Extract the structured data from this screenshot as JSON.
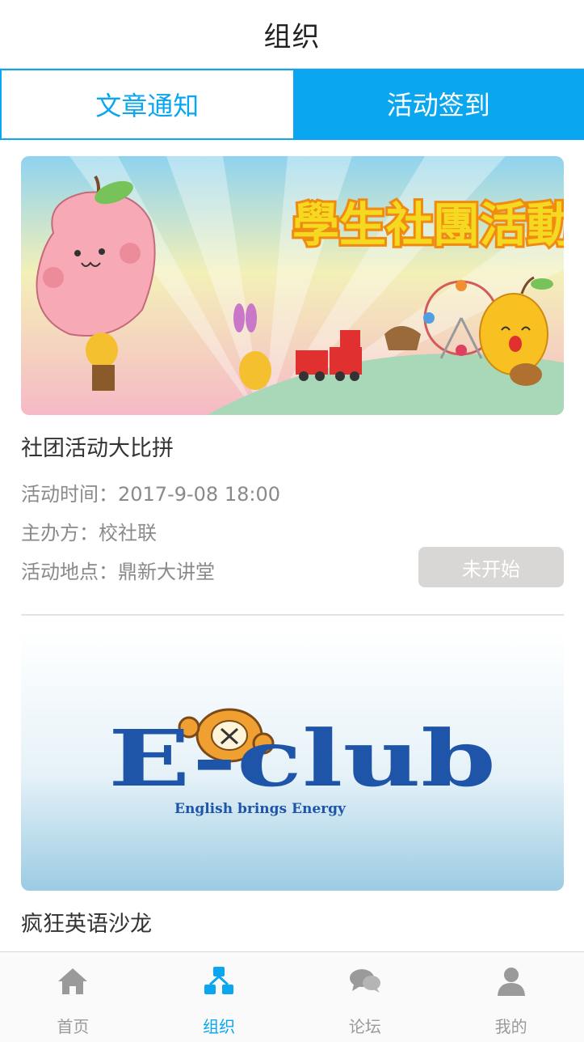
{
  "header": {
    "title": "组织"
  },
  "tabs": [
    {
      "label": "文章通知",
      "active": false
    },
    {
      "label": "活动签到",
      "active": true
    }
  ],
  "activities": [
    {
      "banner_text": "學生社團活動",
      "title": "社团活动大比拼",
      "time": "活动时间：2017-9-08 18:00",
      "organizer": "主办方：校社联",
      "location": "活动地点：鼎新大讲堂",
      "status": "未开始"
    },
    {
      "banner_title": "E-club",
      "banner_slogan": "English brings Energy",
      "title": "疯狂英语沙龙"
    }
  ],
  "tabbar": [
    {
      "label": "首页",
      "icon": "home-icon"
    },
    {
      "label": "组织",
      "icon": "organization-icon"
    },
    {
      "label": "论坛",
      "icon": "chat-bubbles-icon"
    },
    {
      "label": "我的",
      "icon": "user-icon"
    }
  ],
  "colors": {
    "accent": "#0aa7f0",
    "status_bg": "#d9d6d6"
  }
}
